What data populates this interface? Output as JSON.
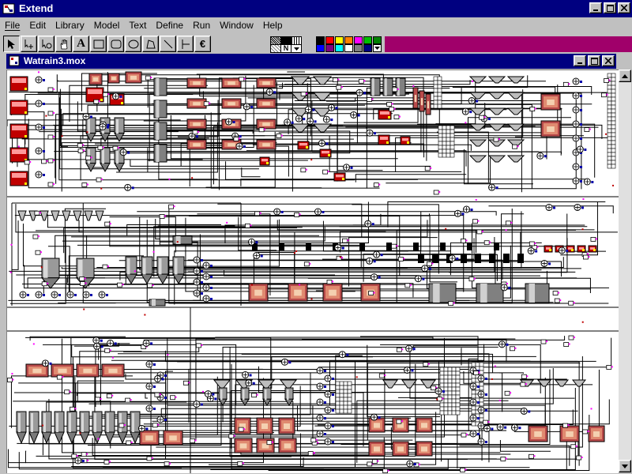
{
  "app": {
    "title": "Extend",
    "window_controls": {
      "minimize_icon": "minimize-icon",
      "maximize_icon": "maximize-icon",
      "close_icon": "close-icon"
    }
  },
  "menu": {
    "items": [
      {
        "label": "File",
        "mnemonic": "F"
      },
      {
        "label": "Edit",
        "mnemonic": "E"
      },
      {
        "label": "Library",
        "mnemonic": "L"
      },
      {
        "label": "Model",
        "mnemonic": "M"
      },
      {
        "label": "Text",
        "mnemonic": "T"
      },
      {
        "label": "Define",
        "mnemonic": "D"
      },
      {
        "label": "Run",
        "mnemonic": "R"
      },
      {
        "label": "Window",
        "mnemonic": "W"
      },
      {
        "label": "Help",
        "mnemonic": "H"
      }
    ]
  },
  "toolbar": {
    "tools": [
      {
        "name": "pointer-tool",
        "icon": "arrow-icon",
        "selected": true
      },
      {
        "name": "connect-tool",
        "icon": "crosshair-icon"
      },
      {
        "name": "clone-tool",
        "icon": "clone-icon"
      },
      {
        "name": "hand-tool",
        "icon": "hand-icon"
      },
      {
        "name": "text-tool",
        "icon": "letter-a-icon",
        "glyph": "A"
      },
      {
        "name": "rectangle-tool",
        "icon": "rectangle-icon"
      },
      {
        "name": "rounded-rect-tool",
        "icon": "rounded-rectangle-icon"
      },
      {
        "name": "oval-tool",
        "icon": "oval-icon"
      },
      {
        "name": "polygon-tool",
        "icon": "polygon-icon"
      },
      {
        "name": "line-tool",
        "icon": "line-icon"
      },
      {
        "name": "hierarchy-tool",
        "icon": "connector-icon"
      },
      {
        "name": "block-tool",
        "icon": "euro-block-icon",
        "glyph": "€"
      }
    ],
    "pattern_label": "N",
    "colors": [
      "#000000",
      "#ff0000",
      "#ffff00",
      "#ff8000",
      "#ff00ff",
      "#00ff00",
      "#008000",
      "#00ffff",
      "#0000ff",
      "#800080",
      "#ffffff",
      "#808080"
    ],
    "accent_color": "#a0006a"
  },
  "document": {
    "title": "Watrain3.mox"
  },
  "theme": {
    "titlebar": "#000080",
    "face": "#c0c0c0",
    "canvas": "#ffffff"
  }
}
